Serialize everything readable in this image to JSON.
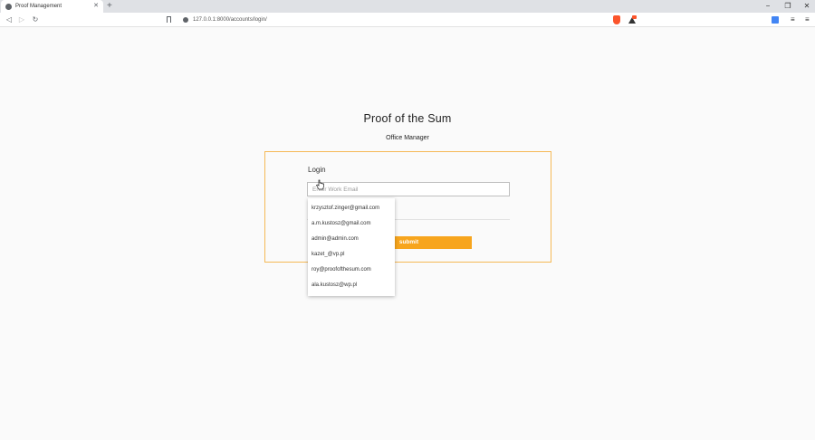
{
  "browser": {
    "tab_title": "Proof Management",
    "tab_close": "✕",
    "new_tab": "+",
    "url": "127.0.0.1:8000/accounts/login/",
    "window_controls": {
      "minimize": "−",
      "restore": "❐",
      "close": "✕"
    },
    "nav": {
      "back": "◁",
      "forward": "▷",
      "reload": "↻"
    },
    "playlist": "≡",
    "menu": "≡"
  },
  "page": {
    "title": "Proof of the Sum",
    "subtitle": "Office Manager"
  },
  "login_form": {
    "heading": "Login",
    "email_placeholder": "Enter Work Email",
    "submit_label": "submit"
  },
  "autofill_suggestions": [
    "krzysztof.zinger@gmail.com",
    "a.m.kustosz@gmail.com",
    "admin@admin.com",
    "kazet_@vp.pl",
    "roy@proofofthesum.com",
    "ala.kustosz@wp.pl"
  ],
  "colors": {
    "accent": "#f7a51d",
    "card_border": "#f5b956"
  },
  "icons": {
    "favicon": "globe-icon",
    "site_info": "info-icon",
    "bookmark": "bookmark-icon",
    "brave_shields": "brave-shield-icon",
    "brave_rewards": "rewards-icon",
    "translate": "translate-icon",
    "cursor": "hand-cursor-icon"
  }
}
